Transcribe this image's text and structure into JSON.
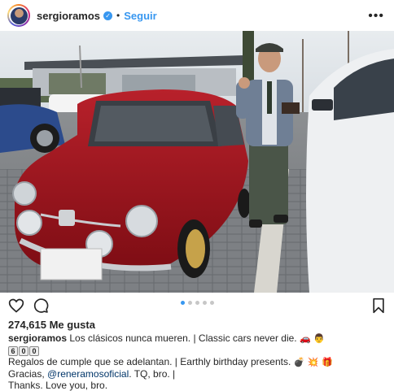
{
  "header": {
    "username": "sergioramos",
    "verified_icon": "verified-badge-icon",
    "separator": "•",
    "follow_label": "Seguir",
    "more_label": "•••"
  },
  "photo": {
    "description_icon": "post-photo"
  },
  "actions": {
    "like_icon": "heart-icon",
    "comment_icon": "comment-icon",
    "save_icon": "bookmark-icon"
  },
  "carousel": {
    "total": 5,
    "active_index": 0
  },
  "likes": {
    "text": "274,615 Me gusta"
  },
  "caption": {
    "username": "sergioramos",
    "line1_text": "Los clásicos nunca mueren. | Classic cars never die.",
    "line1_emoji": "🚗 👨",
    "line2_digits": [
      "6",
      "0",
      "0"
    ],
    "line3_text": "Regalos de cumple que se adelantan. | Earthly birthday presents.",
    "line3_emoji": "💣 💥 🎁",
    "line4_prefix": "Gracias,",
    "line4_mention": "@reneramosoficial",
    "line4_suffix": ". TQ, bro. |",
    "line5_text": "Thanks. Love you, bro."
  },
  "colors": {
    "link_blue": "#3897f0",
    "mention_blue": "#003569",
    "car_red": "#a3121c"
  }
}
